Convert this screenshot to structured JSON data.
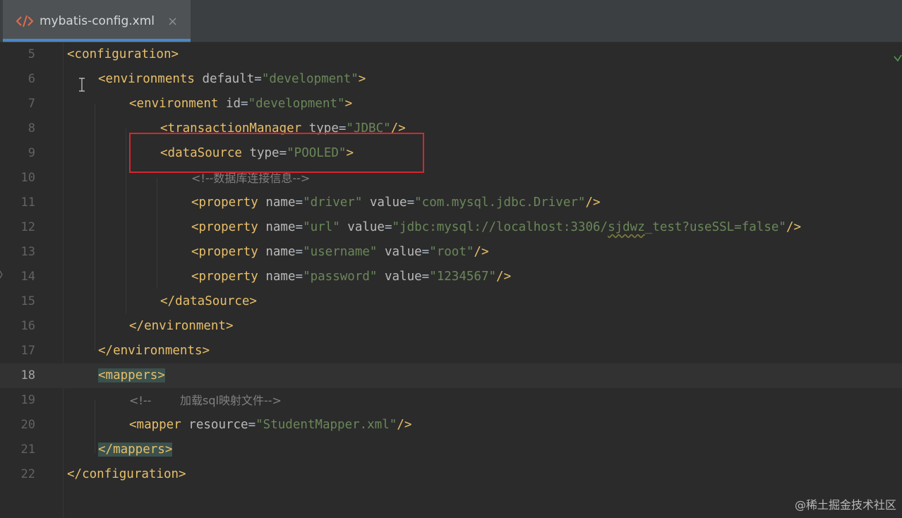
{
  "tab": {
    "icon": "xml-code-icon",
    "title": "mybatis-config.xml",
    "close": "×"
  },
  "editor": {
    "current_line": 18,
    "lines": [
      {
        "n": "5",
        "indent": 0,
        "parts": [
          [
            "tag",
            "<configuration>"
          ]
        ]
      },
      {
        "n": "6",
        "indent": 1,
        "parts": [
          [
            "tag",
            "<environments "
          ],
          [
            "attr",
            "default"
          ],
          [
            "plain",
            "="
          ],
          [
            "val",
            "\"development\""
          ],
          [
            "tag",
            ">"
          ]
        ]
      },
      {
        "n": "7",
        "indent": 2,
        "parts": [
          [
            "tag",
            "<environment "
          ],
          [
            "attr",
            "id"
          ],
          [
            "plain",
            "="
          ],
          [
            "val",
            "\"development\""
          ],
          [
            "tag",
            ">"
          ]
        ]
      },
      {
        "n": "8",
        "indent": 3,
        "parts": [
          [
            "tag",
            "<transactionManager "
          ],
          [
            "attr",
            "type"
          ],
          [
            "plain",
            "="
          ],
          [
            "val",
            "\"JDBC\""
          ],
          [
            "tag",
            "/>"
          ]
        ]
      },
      {
        "n": "9",
        "indent": 3,
        "parts": [
          [
            "tag",
            "<dataSource "
          ],
          [
            "attr",
            "type"
          ],
          [
            "plain",
            "="
          ],
          [
            "val",
            "\"POOLED\""
          ],
          [
            "tag",
            ">"
          ]
        ]
      },
      {
        "n": "10",
        "indent": 4,
        "parts": [
          [
            "cmt",
            "<!--数据库连接信息-->"
          ]
        ]
      },
      {
        "n": "11",
        "indent": 4,
        "parts": [
          [
            "tag",
            "<property "
          ],
          [
            "attr",
            "name"
          ],
          [
            "plain",
            "="
          ],
          [
            "val",
            "\"driver\" "
          ],
          [
            "attr",
            "value"
          ],
          [
            "plain",
            "="
          ],
          [
            "val",
            "\"com.mysql.jdbc.Driver\""
          ],
          [
            "tag",
            "/>"
          ]
        ]
      },
      {
        "n": "12",
        "indent": 4,
        "parts": [
          [
            "tag",
            "<property "
          ],
          [
            "attr",
            "name"
          ],
          [
            "plain",
            "="
          ],
          [
            "val",
            "\"url\" "
          ],
          [
            "attr",
            "value"
          ],
          [
            "plain",
            "="
          ],
          [
            "val",
            "\"jdbc:mysql://localhost:3306/"
          ],
          [
            "valsq",
            "sjdwz"
          ],
          [
            "val",
            "_test?useSSL=false\""
          ],
          [
            "tag",
            "/>"
          ]
        ]
      },
      {
        "n": "13",
        "indent": 4,
        "parts": [
          [
            "tag",
            "<property "
          ],
          [
            "attr",
            "name"
          ],
          [
            "plain",
            "="
          ],
          [
            "val",
            "\"username\" "
          ],
          [
            "attr",
            "value"
          ],
          [
            "plain",
            "="
          ],
          [
            "val",
            "\"root\""
          ],
          [
            "tag",
            "/>"
          ]
        ]
      },
      {
        "n": "14",
        "indent": 4,
        "parts": [
          [
            "tag",
            "<property "
          ],
          [
            "attr",
            "name"
          ],
          [
            "plain",
            "="
          ],
          [
            "val",
            "\"password\" "
          ],
          [
            "attr",
            "value"
          ],
          [
            "plain",
            "="
          ],
          [
            "val",
            "\"1234567\""
          ],
          [
            "tag",
            "/>"
          ]
        ]
      },
      {
        "n": "15",
        "indent": 3,
        "parts": [
          [
            "tag",
            "</dataSource>"
          ]
        ]
      },
      {
        "n": "16",
        "indent": 2,
        "parts": [
          [
            "tag",
            "</environment>"
          ]
        ]
      },
      {
        "n": "17",
        "indent": 1,
        "parts": [
          [
            "tag",
            "</environments>"
          ]
        ]
      },
      {
        "n": "18",
        "indent": 1,
        "parts": [
          [
            "taghl",
            "<mappers>"
          ]
        ]
      },
      {
        "n": "19",
        "indent": 2,
        "parts": [
          [
            "cmt",
            "<!--        加载sql映射文件-->"
          ]
        ]
      },
      {
        "n": "20",
        "indent": 2,
        "parts": [
          [
            "tag",
            "<mapper "
          ],
          [
            "attr",
            "resource"
          ],
          [
            "plain",
            "="
          ],
          [
            "val",
            "\"StudentMapper.xml\""
          ],
          [
            "tag",
            "/>"
          ]
        ]
      },
      {
        "n": "21",
        "indent": 1,
        "parts": [
          [
            "taghl",
            "</mappers>"
          ]
        ]
      },
      {
        "n": "22",
        "indent": 0,
        "parts": [
          [
            "tag",
            "</configuration>"
          ]
        ]
      }
    ]
  },
  "annotation": {
    "highlight_box_color": "#d7262e"
  },
  "watermark": "@稀土掘金技术社区"
}
